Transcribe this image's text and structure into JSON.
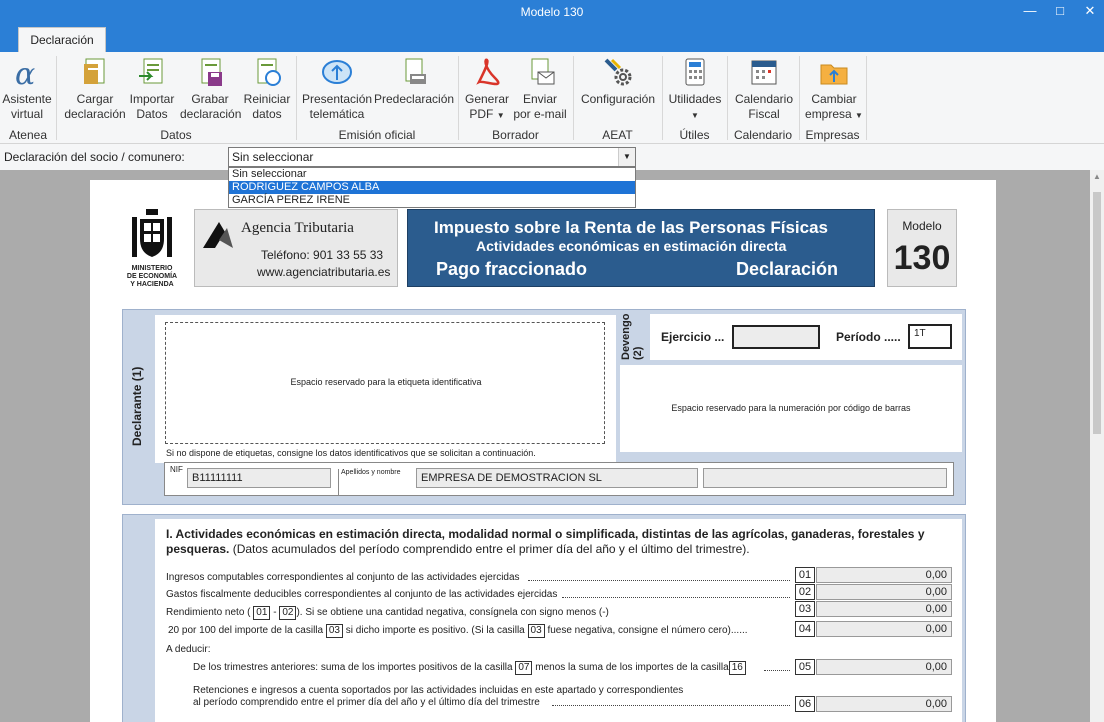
{
  "window": {
    "title": "Modelo 130"
  },
  "tabs": [
    {
      "label": "Declaración"
    }
  ],
  "ribbon": {
    "buttons": [
      {
        "label1": "Asistente",
        "label2": "virtual"
      },
      {
        "label1": "Cargar",
        "label2": "declaración"
      },
      {
        "label1": "Importar",
        "label2": "Datos"
      },
      {
        "label1": "Grabar",
        "label2": "declaración"
      },
      {
        "label1": "Reiniciar",
        "label2": "datos"
      },
      {
        "label1": "Presentación",
        "label2": "telemática"
      },
      {
        "label1": "Predeclaración",
        "label2": ""
      },
      {
        "label1": "Generar",
        "label2": "PDF"
      },
      {
        "label1": "Enviar",
        "label2": "por e-mail"
      },
      {
        "label1": "Configuración",
        "label2": ""
      },
      {
        "label1": "Utilidades",
        "label2": ""
      },
      {
        "label1": "Calendario",
        "label2": "Fiscal"
      },
      {
        "label1": "Cambiar",
        "label2": "empresa"
      }
    ],
    "groups": [
      "Atenea",
      "Datos",
      "Emisión oficial",
      "Borrador",
      "AEAT",
      "Útiles",
      "Calendario",
      "Empresas"
    ]
  },
  "socio": {
    "label": "Declaración del socio / comunero:",
    "selected": "Sin seleccionar",
    "options": [
      "Sin seleccionar",
      "RODRIGUEZ CAMPOS ALBA",
      "GARCÍA PEREZ IRENE"
    ]
  },
  "form": {
    "ministry": [
      "MINISTERIO",
      "DE ECONOMÍA",
      "Y HACIENDA"
    ],
    "agency": "Agencia Tributaria",
    "phone": "Teléfono: 901 33 55 33",
    "web": "www.agenciatributaria.es",
    "tax_title": "Impuesto sobre la Renta de las Personas Físicas",
    "tax_subtitle": "Actividades económicas en estimación directa",
    "pago": "Pago fraccionado",
    "declaracion": "Declaración",
    "modelo_label": "Modelo",
    "modelo_num": "130",
    "declarante_label": "Declarante (1)",
    "devengo_label": "Devengo (2)",
    "label_space": "Espacio reservado para la etiqueta identificativa",
    "barcode_space": "Espacio reservado para la numeración por código de barras",
    "ejercicio_label": "Ejercicio ...",
    "periodo_label": "Período .....",
    "ejercicio_value": "",
    "periodo_value": "1T",
    "no_labels_note": "Si no dispone de etiquetas, consigne los datos identificativos que se solicitan a continuación.",
    "nif_label": "NIF",
    "nif_value": "B11111111",
    "nombre_label": "Apellidos y nombre",
    "nombre_value": "EMPRESA DE DEMOSTRACION SL",
    "section1_title": "I.  Actividades económicas en estimación directa, modalidad normal o simplificada, distintas de las agrícolas, ganaderas, forestales y",
    "section1_title2": "pesqueras.",
    "section1_sub": " (Datos acumulados del período comprendido entre el primer día del año y el último del trimestre).",
    "rows": [
      {
        "text": "Ingresos computables correspondientes al conjunto de las actividades ejercidas",
        "casilla": "01",
        "value": "0,00"
      },
      {
        "text": "Gastos fiscalmente deducibles correspondientes al conjunto de las actividades ejercidas",
        "casilla": "02",
        "value": "0,00"
      },
      {
        "text_a": "Rendimiento neto (",
        "ref1": "01",
        "text_b": "-",
        "ref2": "02",
        "text_c": "). Si se obtiene una cantidad negativa, consígnela con signo menos (-)",
        "casilla": "03",
        "value": "0,00"
      },
      {
        "text_a": "20 por 100 del importe de la casilla",
        "ref1": "03",
        "text_b": "si dicho importe es positivo. (Si  la casilla",
        "ref2": "03",
        "text_c": "fuese negativa, consigne el número cero)......",
        "casilla": "04",
        "value": "0,00"
      }
    ],
    "a_deducir": "A deducir:",
    "row05": {
      "text_a": "De los trimestres anteriores: suma de los importes positivos de la casilla",
      "ref1": "07",
      "text_b": "menos la suma de los importes de la  casilla",
      "ref2": "16",
      "casilla": "05",
      "value": "0,00"
    },
    "row06": {
      "text1": "Retenciones e ingresos a cuenta soportados por las actividades incluidas en este apartado y correspondientes",
      "text2": "al período comprendido entre el primer día del año y el último día del trimestre",
      "casilla": "06",
      "value": "0,00"
    }
  }
}
